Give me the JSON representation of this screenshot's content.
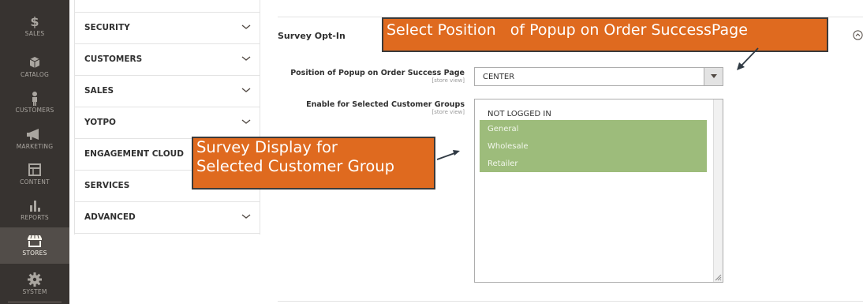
{
  "admin_nav": {
    "items": [
      {
        "label": "SALES",
        "icon": "dollar-icon"
      },
      {
        "label": "CATALOG",
        "icon": "cube-icon"
      },
      {
        "label": "CUSTOMERS",
        "icon": "person-icon"
      },
      {
        "label": "MARKETING",
        "icon": "megaphone-icon"
      },
      {
        "label": "CONTENT",
        "icon": "layout-icon"
      },
      {
        "label": "REPORTS",
        "icon": "bar-chart-icon"
      },
      {
        "label": "STORES",
        "icon": "store-icon",
        "active": true
      },
      {
        "label": "SYSTEM",
        "icon": "gear-icon"
      }
    ]
  },
  "config_tabs": [
    {
      "label": "SECURITY",
      "icon": "chevron-down-icon"
    },
    {
      "label": "CUSTOMERS",
      "icon": "chevron-down-icon"
    },
    {
      "label": "SALES",
      "icon": "chevron-down-icon"
    },
    {
      "label": "YOTPO",
      "icon": "chevron-down-icon"
    },
    {
      "label": "ENGAGEMENT CLOUD",
      "icon": "chevron-down-icon"
    },
    {
      "label": "SERVICES",
      "icon": "chevron-down-icon"
    },
    {
      "label": "ADVANCED",
      "icon": "chevron-down-icon"
    }
  ],
  "section": {
    "title": "Survey Opt-In",
    "collapse_icon": "chevron-up-circle-icon",
    "fields": {
      "position": {
        "label": "Position of Popup on Order Success Page",
        "scope": "[store view]",
        "value": "CENTER"
      },
      "groups": {
        "label": "Enable for Selected Customer Groups",
        "scope": "[store view]",
        "options": [
          {
            "label": "NOT LOGGED IN",
            "selected": false
          },
          {
            "label": "General",
            "selected": true
          },
          {
            "label": "Wholesale",
            "selected": true
          },
          {
            "label": "Retailer",
            "selected": true
          }
        ]
      }
    }
  },
  "annotations": {
    "top": "Select Position   of Popup on Order SuccessPage",
    "left_line1": "Survey Display for",
    "left_line2": "Selected Customer Group"
  },
  "colors": {
    "nav_bg": "#373330",
    "nav_active": "#524d49",
    "selected_option": "#9dbc7b",
    "callout": "#df6a1f"
  }
}
